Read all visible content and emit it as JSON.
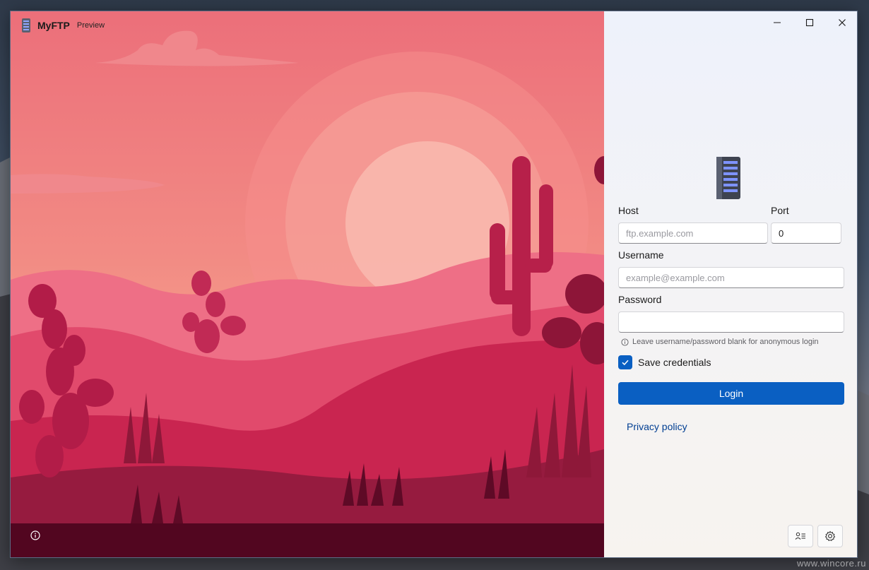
{
  "window": {
    "app_name": "MyFTP",
    "app_badge": "Preview"
  },
  "form": {
    "host_label": "Host",
    "host_placeholder": "ftp.example.com",
    "host_value": "",
    "port_label": "Port",
    "port_value": "0",
    "username_label": "Username",
    "username_placeholder": "example@example.com",
    "username_value": "",
    "password_label": "Password",
    "password_value": "",
    "hint": "Leave username/password blank for anonymous login",
    "save_credentials_label": "Save credentials",
    "save_credentials_checked": true,
    "login_label": "Login",
    "privacy_label": "Privacy policy"
  },
  "icons": {
    "app": "server-rack-icon",
    "hero_info": "info-icon",
    "hint": "info-icon",
    "check": "checkmark-icon",
    "accounts": "contact-card-icon",
    "settings": "gear-icon",
    "minimize": "minimize-icon",
    "maximize": "maximize-icon",
    "close": "close-icon"
  },
  "colors": {
    "accent": "#0a5fc2",
    "link": "#003e92"
  },
  "watermark": "www.wincore.ru"
}
